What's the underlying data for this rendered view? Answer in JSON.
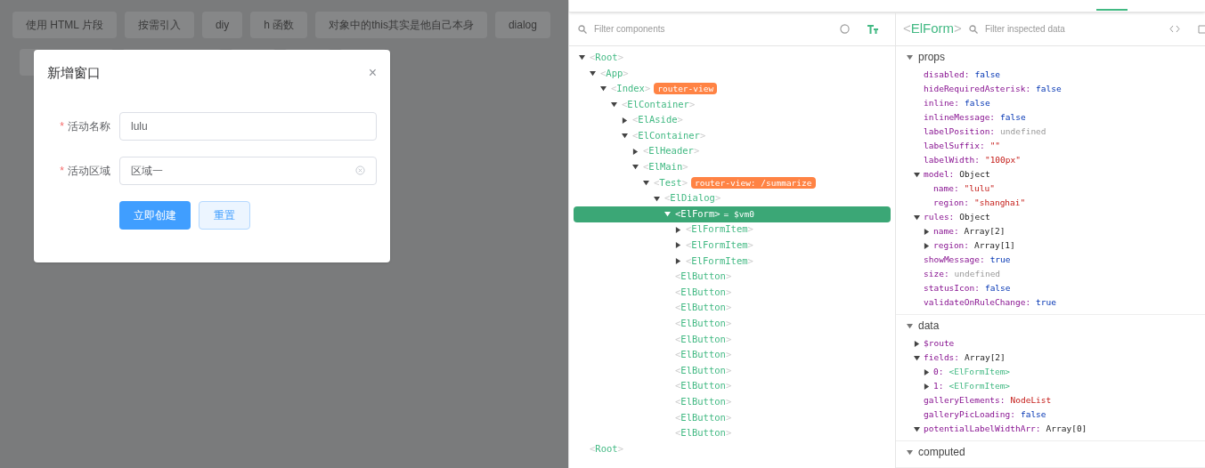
{
  "app": {
    "buttons": [
      "使用 HTML 片段",
      "按需引入",
      "diy",
      "h 函数",
      "对象中的this其实是他自己本身",
      "dialog"
    ]
  },
  "dialog": {
    "title": "新增窗口",
    "close": "×",
    "fields": [
      {
        "kind": "input",
        "marker": "*",
        "label": "活动名称",
        "value": "lulu"
      },
      {
        "kind": "select",
        "marker": "*",
        "label": "活动区域",
        "value": "区域一"
      }
    ],
    "actions": [
      {
        "label": "立即创建",
        "kind": "primary"
      },
      {
        "label": "重置",
        "kind": "plain"
      }
    ]
  },
  "devtools": {
    "filter": {
      "placeholder": "Filter components"
    },
    "tree": [
      {
        "tag": "<Root>",
        "selected": false,
        "expanded": true,
        "children": [
          {
            "tag": "<App>",
            "selected": false,
            "expanded": true,
            "children": [
              {
                "tag": "<Index>",
                "badge": "router-view",
                "selected": false,
                "expanded": true,
                "children": [
                  {
                    "tag": "<ElContainer>",
                    "selected": false,
                    "expanded": true,
                    "children": [
                      {
                        "tag": "<ElAside>",
                        "selected": false,
                        "expanded": false
                      },
                      {
                        "tag": "<ElContainer>",
                        "selected": false,
                        "expanded": true,
                        "children": [
                          {
                            "tag": "<ElHeader>",
                            "selected": false,
                            "expanded": false
                          },
                          {
                            "tag": "<ElMain>",
                            "selected": false,
                            "expanded": true,
                            "children": [
                              {
                                "tag": "<Test>",
                                "badge": "router-view: /summarize",
                                "selected": false,
                                "expanded": true,
                                "children": [
                                  {
                                    "tag": "<ElDialog>",
                                    "selected": false,
                                    "expanded": true,
                                    "children": [
                                      {
                                        "tag": "<ElForm>",
                                        "suffix": "= $vm0",
                                        "selected": true,
                                        "expanded": true,
                                        "children": [
                                          {
                                            "tag": "<ElFormItem>",
                                            "selected": false,
                                            "expanded": false
                                          },
                                          {
                                            "tag": "<ElFormItem>",
                                            "selected": false,
                                            "expanded": false
                                          },
                                          {
                                            "tag": "<ElFormItem>",
                                            "selected": false,
                                            "expanded": false
                                          }
                                        ]
                                      },
                                      {
                                        "tag": "<ElButton>",
                                        "selected": false
                                      },
                                      {
                                        "tag": "<ElButton>",
                                        "selected": false
                                      },
                                      {
                                        "tag": "<ElButton>",
                                        "selected": false
                                      },
                                      {
                                        "tag": "<ElButton>",
                                        "selected": false
                                      },
                                      {
                                        "tag": "<ElButton>",
                                        "selected": false
                                      },
                                      {
                                        "tag": "<ElButton>",
                                        "selected": false
                                      },
                                      {
                                        "tag": "<ElButton>",
                                        "selected": false
                                      },
                                      {
                                        "tag": "<ElButton>",
                                        "selected": false
                                      },
                                      {
                                        "tag": "<ElButton>",
                                        "selected": false
                                      },
                                      {
                                        "tag": "<ElButton>",
                                        "selected": false
                                      },
                                      {
                                        "tag": "<ElButton>",
                                        "selected": false
                                      }
                                    ]
                                  }
                                ]
                              }
                            ]
                          }
                        ]
                      }
                    ]
                  }
                ]
              }
            ]
          }
        ]
      },
      {
        "tag": "<Root>",
        "selected": false
      }
    ],
    "inspector": {
      "component": "<ElForm>",
      "filter": {
        "placeholder": "Filter inspected data"
      },
      "sections": [
        {
          "title": "props",
          "expanded": true,
          "entries": [
            {
              "key": "disabled:",
              "value": "false",
              "kind": "boolean"
            },
            {
              "key": "hideRequiredAsterisk:",
              "value": "false",
              "kind": "boolean"
            },
            {
              "key": "inline:",
              "value": "false",
              "kind": "boolean"
            },
            {
              "key": "inlineMessage:",
              "value": "false",
              "kind": "boolean"
            },
            {
              "key": "labelPosition:",
              "value": "undefined",
              "kind": "undefined"
            },
            {
              "key": "labelSuffix:",
              "value": "\"\"",
              "kind": "string"
            },
            {
              "key": "labelWidth:",
              "value": "\"100px\"",
              "kind": "string"
            },
            {
              "key": "model:",
              "value": "Object",
              "kind": "object",
              "expanded": true,
              "children": [
                {
                  "key": "name:",
                  "value": "\"lulu\"",
                  "kind": "string"
                },
                {
                  "key": "region:",
                  "value": "\"shanghai\"",
                  "kind": "string"
                }
              ]
            },
            {
              "key": "rules:",
              "value": "Object",
              "kind": "object",
              "expanded": true,
              "children": [
                {
                  "key": "name:",
                  "value": "Array[2]",
                  "kind": "object",
                  "expanded": false
                },
                {
                  "key": "region:",
                  "value": "Array[1]",
                  "kind": "object",
                  "expanded": false
                }
              ]
            },
            {
              "key": "showMessage:",
              "value": "true",
              "kind": "boolean"
            },
            {
              "key": "size:",
              "value": "undefined",
              "kind": "undefined"
            },
            {
              "key": "statusIcon:",
              "value": "false",
              "kind": "boolean"
            },
            {
              "key": "validateOnRuleChange:",
              "value": "true",
              "kind": "boolean"
            }
          ]
        },
        {
          "title": "data",
          "expanded": true,
          "entries": [
            {
              "key": "$route",
              "kind": "object",
              "expanded": false
            },
            {
              "key": "fields:",
              "value": "Array[2]",
              "kind": "object",
              "expanded": true,
              "children": [
                {
                  "key": "0:",
                  "value": "<ElFormItem>",
                  "kind": "component",
                  "expanded": false
                },
                {
                  "key": "1:",
                  "value": "<ElFormItem>",
                  "kind": "component",
                  "expanded": false
                }
              ]
            },
            {
              "key": "galleryElements:",
              "value": "NodeList",
              "kind": "string"
            },
            {
              "key": "galleryPicLoading:",
              "value": "false",
              "kind": "boolean"
            },
            {
              "key": "potentialLabelWidthArr:",
              "value": "Array[0]",
              "kind": "object",
              "expanded": true
            }
          ]
        },
        {
          "title": "computed",
          "expanded": true
        }
      ]
    }
  }
}
